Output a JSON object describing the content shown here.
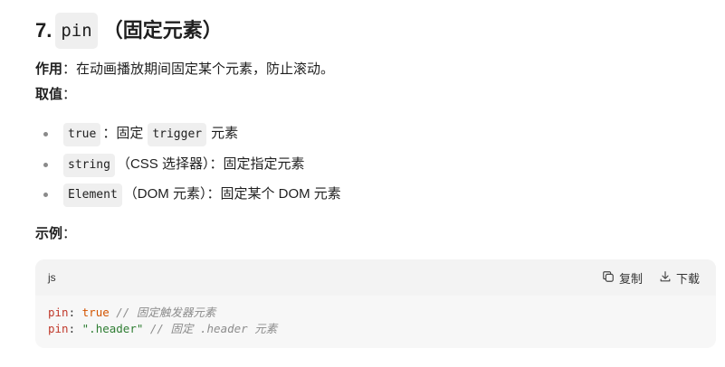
{
  "heading": {
    "number": "7.",
    "code": "pin",
    "title": "（固定元素）"
  },
  "purpose": {
    "label": "作用",
    "colon": "：",
    "text": "在动画播放期间固定某个元素，防止滚动。"
  },
  "values_label": {
    "label": "取值",
    "colon": "："
  },
  "bullets": [
    {
      "code": "true",
      "pre": "",
      "post": "：固定",
      "code2": "trigger",
      "post2": "元素"
    },
    {
      "code": "string",
      "post": "（CSS 选择器）：固定指定元素"
    },
    {
      "code": "Element",
      "post": "（DOM 元素）：固定某个 DOM 元素"
    }
  ],
  "example_label": {
    "label": "示例",
    "colon": "："
  },
  "code_block": {
    "lang": "js",
    "copy_label": "复制",
    "download_label": "下载",
    "lines": [
      {
        "key": "pin",
        "colon": ":",
        "value": "true",
        "comment": "// 固定触发器元素"
      },
      {
        "key": "pin",
        "colon": ":",
        "value": "\".header\"",
        "comment": "// 固定 .header 元素"
      }
    ]
  },
  "icons": {
    "copy": "copy-icon",
    "download": "download-icon"
  }
}
